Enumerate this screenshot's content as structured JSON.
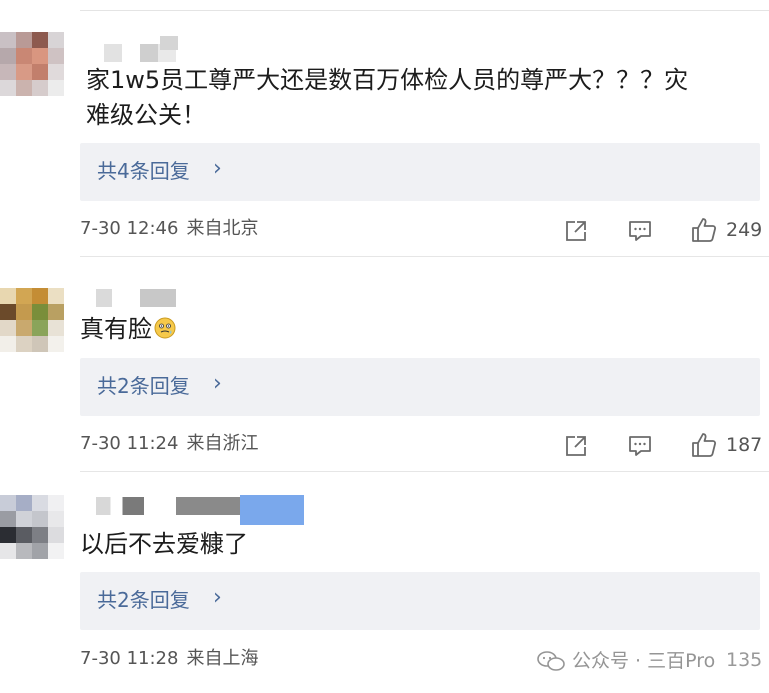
{
  "comments": [
    {
      "text_line1": "家1w5员工尊严大还是数百万体检人员的尊严大？？？灾",
      "text_line2": "难级公关！",
      "replies_label": "共4条回复",
      "date": "7-30 12:46",
      "location": "来自北京",
      "like_count": "249"
    },
    {
      "text_line1": "真有脸",
      "replies_label": "共2条回复",
      "date": "7-30 11:24",
      "location": "来自浙江",
      "like_count": "187"
    },
    {
      "text_line1": "以后不去爱糠了",
      "replies_label": "共2条回复",
      "date": "7-30 11:28",
      "location": "来自上海",
      "like_count": "135"
    }
  ],
  "icons": {
    "share": "share-icon",
    "comment": "comment-icon",
    "like": "thumbs-up-icon",
    "chevron": "chevron-right-icon"
  },
  "watermark": {
    "label": "公众号 · 三百Pro"
  },
  "colors": {
    "reply_link": "#4a6a99",
    "reply_bg": "#f0f1f4",
    "meta_text": "#555555"
  }
}
